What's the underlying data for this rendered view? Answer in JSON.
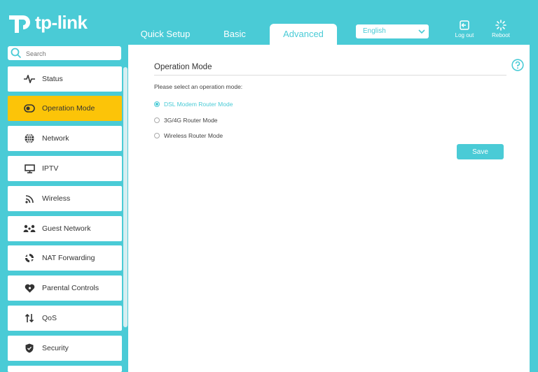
{
  "brand": {
    "logo_text": "tp-link"
  },
  "nav_tabs": [
    {
      "label": "Quick Setup"
    },
    {
      "label": "Basic"
    },
    {
      "label": "Advanced"
    }
  ],
  "language": {
    "selected": "English"
  },
  "header_actions": {
    "logout": "Log out",
    "reboot": "Reboot"
  },
  "search": {
    "placeholder": "Search"
  },
  "sidebar": {
    "active_index": 1,
    "items": [
      {
        "label": "Status",
        "icon": "pulse-icon"
      },
      {
        "label": "Operation Mode",
        "icon": "toggle-icon"
      },
      {
        "label": "Network",
        "icon": "globe-icon"
      },
      {
        "label": "IPTV",
        "icon": "monitor-icon"
      },
      {
        "label": "Wireless",
        "icon": "wifi-icon"
      },
      {
        "label": "Guest Network",
        "icon": "guest-icon"
      },
      {
        "label": "NAT Forwarding",
        "icon": "nat-icon"
      },
      {
        "label": "Parental Controls",
        "icon": "heart-icon"
      },
      {
        "label": "QoS",
        "icon": "updown-arrows-icon"
      },
      {
        "label": "Security",
        "icon": "shield-icon"
      }
    ]
  },
  "main": {
    "title": "Operation Mode",
    "instruction": "Please select an operation mode:",
    "options": [
      {
        "label": "DSL Modem Router Mode",
        "selected": true
      },
      {
        "label": "3G/4G Router Mode",
        "selected": false
      },
      {
        "label": "Wireless Router Mode",
        "selected": false
      }
    ],
    "save_label": "Save"
  },
  "colors": {
    "accent": "#4acbd6",
    "active_item": "#fcc408",
    "panel": "#ffffff"
  }
}
